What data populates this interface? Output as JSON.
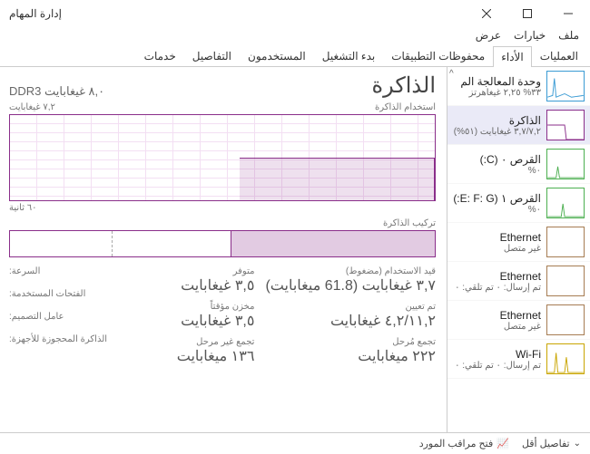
{
  "window": {
    "title": "إدارة المهام"
  },
  "menu": {
    "file": "ملف",
    "options": "خيارات",
    "view": "عرض"
  },
  "tabs": {
    "processes": "العمليات",
    "performance": "الأداء",
    "apphistory": "محفوظات التطبيقات",
    "startup": "بدء التشغيل",
    "users": "المستخدمون",
    "details": "التفاصيل",
    "services": "خدمات"
  },
  "sidebar": {
    "cpu": {
      "title": "وحدة المعالجة الم",
      "sub": "٣٣% ٢,٢٥ غيغاهرتز"
    },
    "memory": {
      "title": "الذاكرة",
      "sub": "٣,٧/٧,٢ غيغابايت (٥١%)"
    },
    "disk0": {
      "title": "القرص ٠ (C:)",
      "sub": "٠%"
    },
    "disk1": {
      "title": "القرص ١ (E: F: G:)",
      "sub": "٠%"
    },
    "eth0": {
      "title": "Ethernet",
      "sub": "غير متصل"
    },
    "eth1": {
      "title": "Ethernet",
      "sub": "تم إرسال: ٠ تم تلقي: ٠"
    },
    "eth2": {
      "title": "Ethernet",
      "sub": "غير متصل"
    },
    "wifi": {
      "title": "Wi-Fi",
      "sub": "تم إرسال: ٠ تم تلقي: ٠"
    }
  },
  "main": {
    "title": "الذاكرة",
    "spec": "٨,٠ غيغابايت DDR3",
    "usage_label": "استخدام الذاكرة",
    "ymax": "٧,٢ غيغابايت",
    "time_label": "٦٠ ثانية",
    "comp_label": "تركيب الذاكرة",
    "stats": {
      "inuse_label": "قيد الاستخدام (مضغوط)",
      "inuse_val": "٣,٧ غيغابايت (61.8 ميغابايت)",
      "avail_label": "متوفر",
      "avail_val": "٣,٥ غيغابايت",
      "committed_label": "تم تعيين",
      "committed_val": "٤,٢/١١,٢ غيغابايت",
      "cached_label": "مخزن مؤقتاً",
      "cached_val": "٣,٥ غيغابايت",
      "paged_label": "تجمع مُرحل",
      "paged_val": "٢٢٢ ميغابايت",
      "nonpaged_label": "تجمع غير مرحل",
      "nonpaged_val": "١٣٦ ميغابايت"
    },
    "specs": {
      "speed": "السرعة:",
      "slots": "الفتحات المستخدمة:",
      "form": "عامل التصميم:",
      "reserved": "الذاكرة المحجوزة للأجهزة:"
    }
  },
  "status": {
    "fewer": "تفاصيل أقل",
    "resmon": "فتح مراقب المورد"
  },
  "chart_data": {
    "type": "area",
    "title": "استخدام الذاكرة",
    "xlabel": "٦٠ ثانية",
    "ylabel": "غيغابايت",
    "ylim": [
      0,
      7.2
    ],
    "x": [
      0,
      5,
      10,
      15,
      20,
      25,
      26,
      60
    ],
    "values": [
      3.7,
      3.7,
      3.7,
      3.7,
      3.7,
      3.7,
      0,
      0
    ]
  }
}
